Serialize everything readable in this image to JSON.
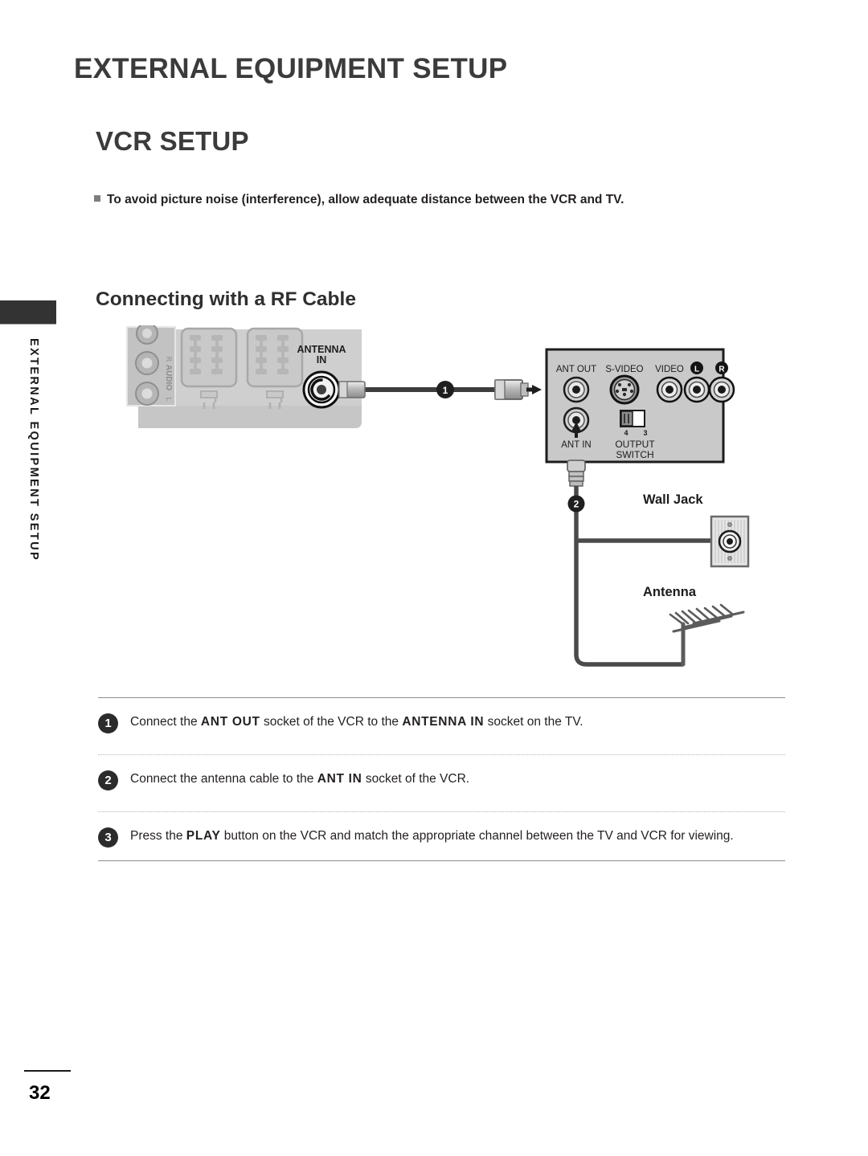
{
  "document": {
    "chapter_title": "EXTERNAL EQUIPMENT SETUP",
    "section_title": "VCR SETUP",
    "subsection_title": "Connecting with a RF Cable",
    "note": "To avoid picture noise (interference), allow adequate distance between the VCR and TV.",
    "side_tab_label": "EXTERNAL EQUIPMENT SETUP",
    "page_number": "32"
  },
  "figure": {
    "tv_panel": {
      "audio_label": "AUDIO",
      "audio_channel_right": "R",
      "audio_channel_left": "L",
      "antenna_label_line1": "ANTENNA",
      "antenna_label_line2": "IN"
    },
    "vcr_panel": {
      "ant_out_label": "ANT OUT",
      "svideo_label": "S-VIDEO",
      "video_label": "VIDEO",
      "left_label": "L",
      "right_label": "R",
      "ant_in_label": "ANT IN",
      "output_switch_line1": "OUTPUT",
      "output_switch_line2": "SWITCH",
      "switch_pos_4": "4",
      "switch_pos_3": "3"
    },
    "callouts": [
      {
        "number": "1"
      },
      {
        "number": "2"
      }
    ],
    "wall_jack_label": "Wall Jack",
    "antenna_label": "Antenna"
  },
  "steps": [
    {
      "number": "1",
      "parts": [
        {
          "text": "Connect the ",
          "bold": false
        },
        {
          "text": "ANT OUT",
          "bold": true
        },
        {
          "text": " socket of the VCR to the ",
          "bold": false
        },
        {
          "text": "ANTENNA IN",
          "bold": true
        },
        {
          "text": " socket on the TV.",
          "bold": false
        }
      ]
    },
    {
      "number": "2",
      "parts": [
        {
          "text": "Connect the antenna cable to the ",
          "bold": false
        },
        {
          "text": "ANT IN",
          "bold": true
        },
        {
          "text": " socket of the VCR.",
          "bold": false
        }
      ]
    },
    {
      "number": "3",
      "parts": [
        {
          "text": "Press the ",
          "bold": false
        },
        {
          "text": "PLAY",
          "bold": true
        },
        {
          "text": " button on the VCR and match the appropriate channel between the TV and VCR for viewing.",
          "bold": false
        }
      ]
    }
  ],
  "colors": {
    "ink": "#231f20",
    "heading": "#3b3b3b",
    "panel_gray": "#c9c9c9",
    "badge": "#2b2b2b"
  }
}
